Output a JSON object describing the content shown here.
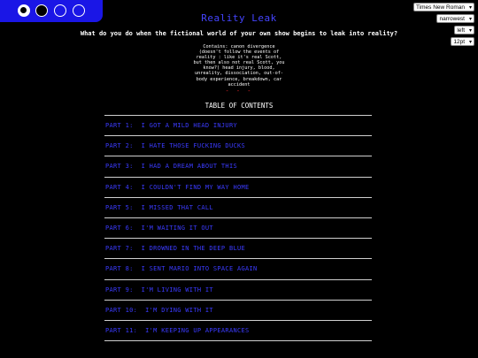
{
  "theme_switcher": {
    "options": [
      "dark-theme-selected",
      "dark-theme",
      "blue-theme",
      "blue-theme-alt"
    ]
  },
  "settings": {
    "font": "Times New Roman",
    "width": "narrowest",
    "align": "left",
    "size": "12pt"
  },
  "work": {
    "title": "Reality Leak",
    "summary": "What do you do when the fictional world of your own show begins to leak into reality?",
    "notes": "Contains: canon divergence (doesn't follow the events of reality : like it's real Scott, but then also not real Scott, you know?) head injury, blood, unreality, dissociation, out-of-body experience, breakdown, car accident",
    "divider": "- - -"
  },
  "toc": {
    "heading": "TABLE OF CONTENTS",
    "items": [
      "PART 1:  I GOT A MILD HEAD INJURY",
      "PART 2:  I HATE THOSE FUCKING DUCKS",
      "PART 3:  I HAD A DREAM ABOUT THIS",
      "PART 4:  I COULDN'T FIND MY WAY HOME",
      "PART 5:  I MISSED THAT CALL",
      "PART 6:  I'M WAITING IT OUT",
      "PART 7:  I DROWNED IN THE DEEP BLUE",
      "PART 8:  I SENT MARIO INTO SPACE AGAIN",
      "PART 9:  I'M LIVING WITH IT",
      "PART 10:  I'M DYING WITH IT",
      "PART 11:  I'M KEEPING UP APPEARANCES"
    ]
  },
  "colors": {
    "background": "#000000",
    "accent_blue": "#3b3bff",
    "panel_blue": "#1a16e6",
    "divider_red": "#e8262a"
  }
}
